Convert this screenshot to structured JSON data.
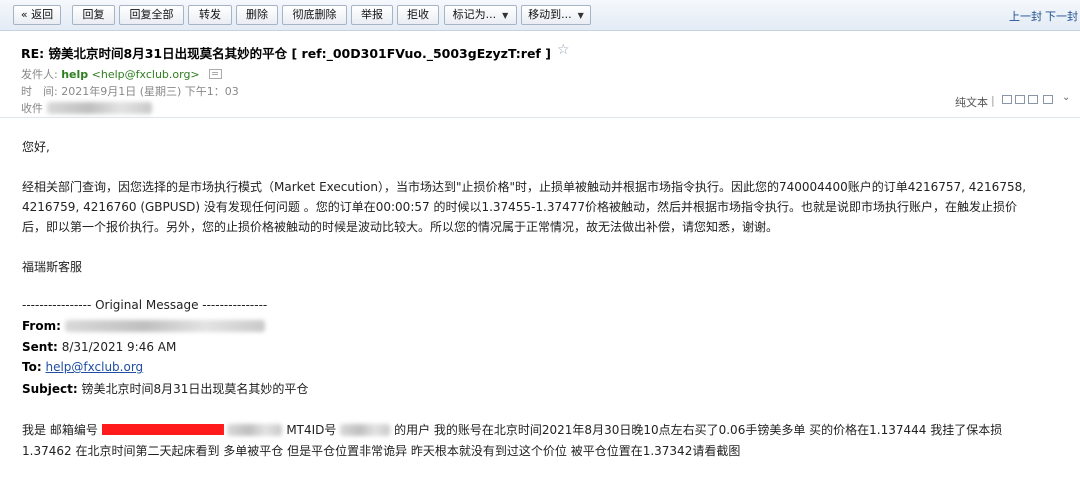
{
  "toolbar": {
    "back": "« 返回",
    "reply": "回复",
    "reply_all": "回复全部",
    "forward": "转发",
    "delete": "删除",
    "delete_permanently": "彻底删除",
    "report": "举报",
    "reject": "拒收",
    "mark_as": "标记为...",
    "move_to": "移动到...",
    "prev": "上一封",
    "next": "下一封"
  },
  "mail": {
    "subject": "RE: 镑美北京时间8月31日出现莫名其妙的平仓 [ ref:_00D301FVuo._5003gEzyzT:ref ]",
    "sender_label": "发件人:",
    "sender_name": "help",
    "sender_address": "<help@fxclub.org>",
    "time_label": "时　间:",
    "time_value": "2021年9月1日 (星期三) 下午1：03",
    "to_label": "收件",
    "plain_text": "纯文本"
  },
  "body": {
    "greeting": "您好,",
    "para1_line1": "经相关部门查询，因您选择的是市场执行模式（Market Execution），当市场达到\"止损价格\"时，止损单被触动并根据市场指令执行。因此您的740004400账户的订单4216757, 4216758,",
    "para1_line2": "4216759, 4216760 (GBPUSD) 没有发现任何问题 。您的订单在00:00:57 的时候以1.37455-1.37477价格被触动，然后并根据市场指令执行。也就是说即市场执行账户，在触发止损价",
    "para1_line3": "后，即以第一个报价执行。另外，您的止损价格被触动的时候是波动比较大。所以您的情况属于正常情况，故无法做出补偿，请您知悉，谢谢。",
    "signature": "福瑞斯客服",
    "original_divider": "---------------- Original Message ---------------",
    "from_label": "From:",
    "sent_label": "Sent:",
    "sent_value": "8/31/2021 9:46 AM",
    "to_label": "To:",
    "to_value": "help@fxclub.org",
    "subject_label": "Subject:",
    "subject_value": "镑美北京时间8月31日出现莫名其妙的平仓",
    "quote_line1_a": "我是 邮箱编号",
    "quote_line1_b": "MT4ID号",
    "quote_line1_c": "的用户 我的账号在北京时间2021年8月30日晚10点左右买了0.06手镑美多单 买的价格在1.137444 我挂了保本损",
    "quote_line2": "1.37462 在北京时间第二天起床看到 多单被平仓 但是平仓位置非常诡异 昨天根本就没有到过这个价位 被平仓位置在1.37342请看截图"
  }
}
